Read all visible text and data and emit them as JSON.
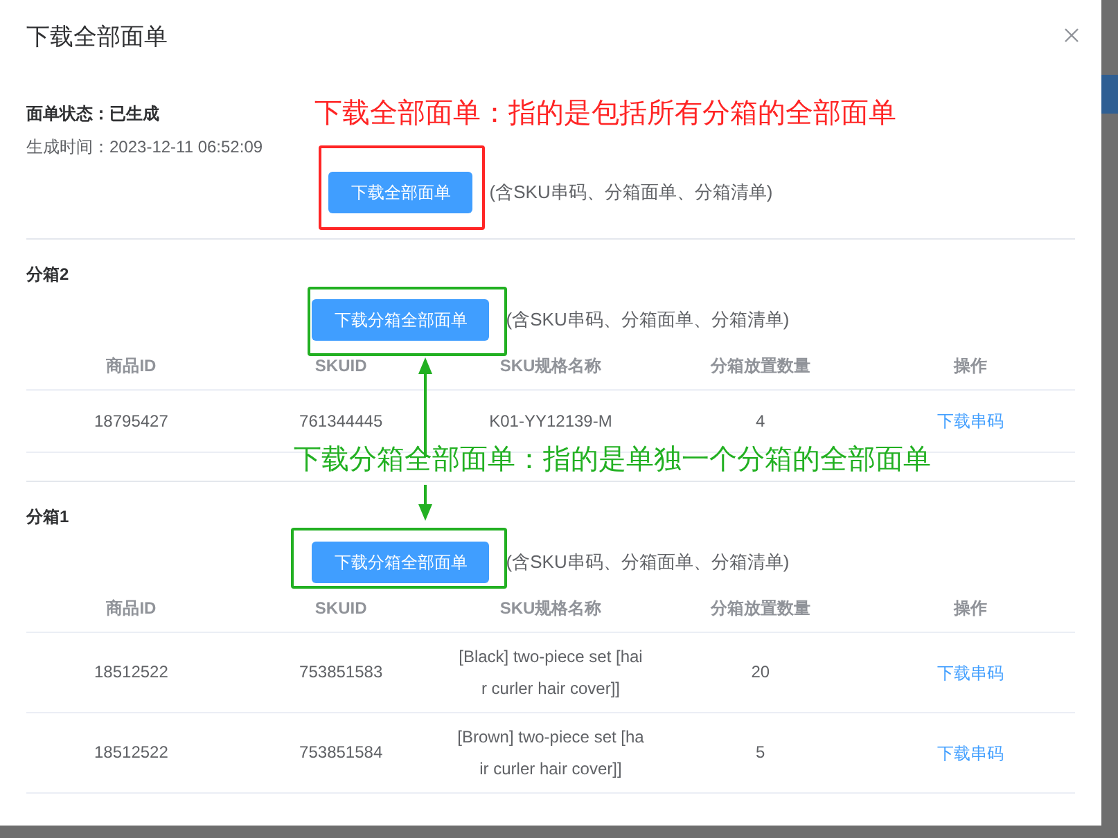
{
  "dialog": {
    "title": "下载全部面单"
  },
  "status": "面单状态：已生成",
  "generated_time": "生成时间：2023-12-11 06:52:09",
  "download_all": {
    "button": "下载全部面单",
    "note": "(含SKU串码、分箱面单、分箱清单)"
  },
  "boxes": [
    {
      "title": "分箱2",
      "button": "下载分箱全部面单",
      "note": "(含SKU串码、分箱面单、分箱清单)",
      "columns": [
        "商品ID",
        "SKUID",
        "SKU规格名称",
        "分箱放置数量",
        "操作"
      ],
      "rows": [
        {
          "cells": [
            "18795427",
            "761344445",
            "K01-YY12139-M",
            "4"
          ],
          "action": "下载串码"
        }
      ]
    },
    {
      "title": "分箱1",
      "button": "下载分箱全部面单",
      "note": "(含SKU串码、分箱面单、分箱清单)",
      "columns": [
        "商品ID",
        "SKUID",
        "SKU规格名称",
        "分箱放置数量",
        "操作"
      ],
      "rows": [
        {
          "cells": [
            "18512522",
            "753851583",
            "[Black] two-piece set [hair curler hair cover]]",
            "20"
          ],
          "action": "下载串码"
        },
        {
          "cells": [
            "18512522",
            "753851584",
            "[Brown] two-piece set [hair curler hair cover]]",
            "5"
          ],
          "action": "下载串码"
        }
      ]
    }
  ],
  "annotations": [
    {
      "kind": "label",
      "text": "下载全部面单：指的是包括所有分箱的全部面单",
      "color": "#ff2525"
    },
    {
      "kind": "frame",
      "color": "#ff2525"
    },
    {
      "kind": "frame",
      "color": "#22b022"
    },
    {
      "kind": "arrow",
      "color": "#22b022"
    },
    {
      "kind": "label",
      "text": "下载分箱全部面单：指的是单独一个分箱的全部面单",
      "color": "#22b022"
    },
    {
      "kind": "arrow",
      "color": "#22b022"
    },
    {
      "kind": "frame",
      "color": "#22b022"
    }
  ]
}
